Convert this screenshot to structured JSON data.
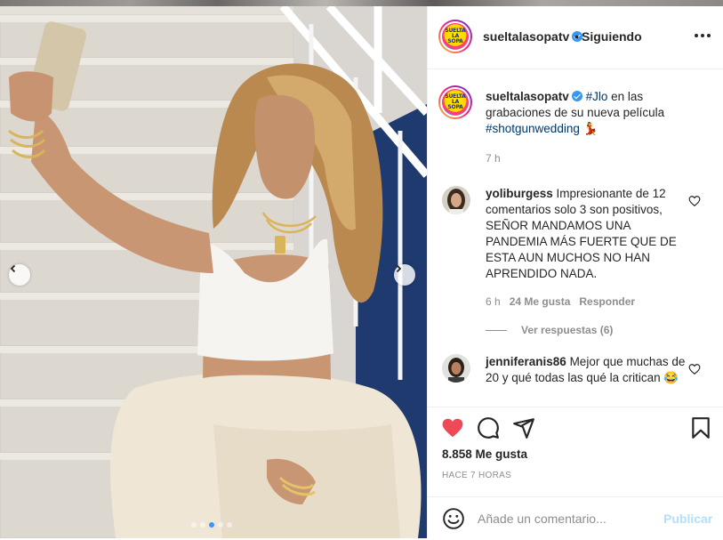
{
  "post": {
    "account": "sueltalasopatv",
    "separator": "•",
    "follow_status": "Siguiendo",
    "logo_lines": [
      "SUELTA",
      "LA",
      "SOPA"
    ],
    "caption": {
      "username": "sueltalasopatv",
      "hashtag1": "#Jlo",
      "text": " en las grabaciones de su nueva película ",
      "hashtag2": "#shotgunwedding",
      "emoji": "💃",
      "time": "7 h"
    },
    "carousel": {
      "dots": 5,
      "active_dot": 2
    }
  },
  "comments": [
    {
      "username": "yoliburgess",
      "text": "Impresionante de 12 comentarios solo 3 son positivos, SEÑOR MANDAMOS UNA PANDEMIA MÁS FUERTE QUE DE ESTA AUN MUCHOS NO HAN APRENDIDO NADA.",
      "time": "6 h",
      "likes": "24 Me gusta",
      "reply": "Responder",
      "view_replies": "Ver respuestas (6)"
    },
    {
      "username": "jenniferanis86",
      "text": "Mejor que muchas de 20 y qué todas las qué la critican 😂"
    }
  ],
  "actions": {
    "likes": "8.858 Me gusta",
    "time_ago": "HACE 7 HORAS",
    "comment_placeholder": "Añade un comentario...",
    "publish": "Publicar"
  },
  "colors": {
    "like_red": "#ed4956",
    "verified_blue": "#3897f0",
    "link_blue": "#00376b",
    "publish_disabled": "#b2dffc",
    "muted_text": "#8e8e8e"
  },
  "icons": [
    "chevron-left-icon",
    "chevron-right-icon",
    "more-icon",
    "heart-filled-icon",
    "comment-icon",
    "share-icon",
    "bookmark-icon",
    "heart-outline-icon",
    "emoji-icon",
    "verified-icon"
  ]
}
